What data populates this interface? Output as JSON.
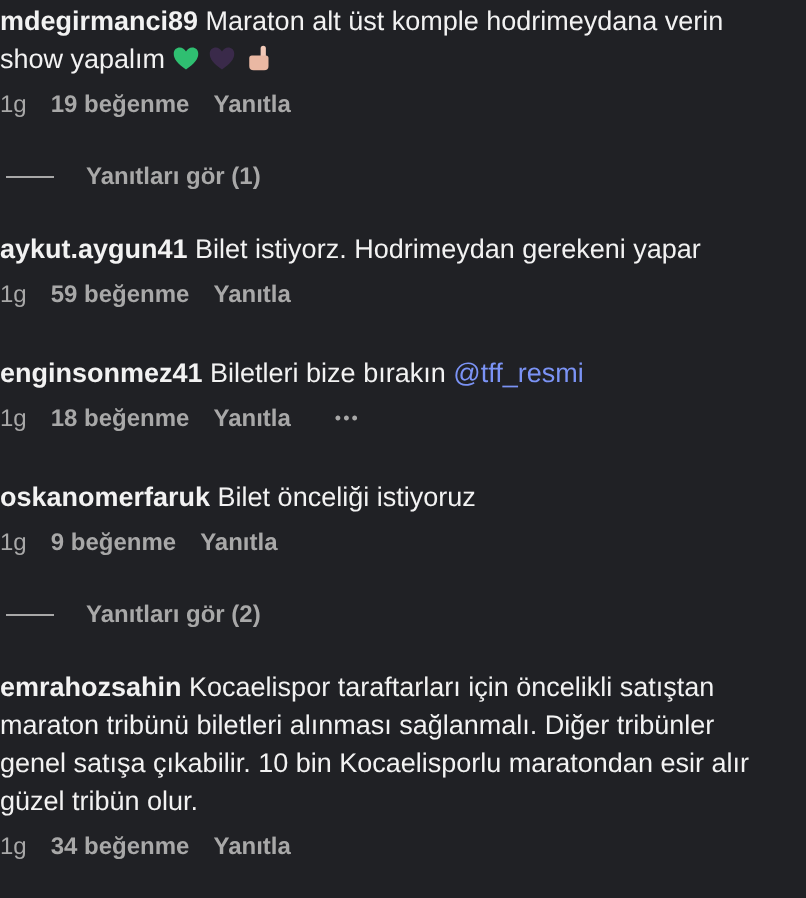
{
  "comments": [
    {
      "user": "mdegirmanci89",
      "text": "Maraton alt üst komple hodrimeydana verin show yapalım",
      "icons": [
        {
          "kind": "heart",
          "color": "#2fbf71"
        },
        {
          "kind": "heart",
          "color": "#3a2a4a"
        },
        {
          "kind": "hand"
        }
      ],
      "time": "1g",
      "likes": "19 beğenme",
      "reply": "Yanıtla",
      "view_replies": "Yanıtları gör (1)"
    },
    {
      "user": "aykut.aygun41",
      "text": "Bilet istiyorz. Hodrimeydan gerekeni yapar",
      "time": "1g",
      "likes": "59 beğenme",
      "reply": "Yanıtla"
    },
    {
      "user": "enginsonmez41",
      "text": "Biletleri bize bırakın",
      "mention": "@tff_resmi",
      "time": "1g",
      "likes": "18 beğenme",
      "reply": "Yanıtla",
      "more": "•••"
    },
    {
      "user": "oskanomerfaruk",
      "text": "Bilet önceliği istiyoruz",
      "time": "1g",
      "likes": "9 beğenme",
      "reply": "Yanıtla",
      "view_replies": "Yanıtları gör (2)"
    },
    {
      "user": "emrahozsahin",
      "text": "Kocaelispor taraftarları için öncelikli satıştan maraton tribünü biletleri alınması sağlanmalı. Diğer tribünler genel satışa çıkabilir. 10 bin Kocaelisporlu maratondan esir alır güzel tribün olur.",
      "time": "1g",
      "likes": "34 beğenme",
      "reply": "Yanıtla"
    }
  ]
}
